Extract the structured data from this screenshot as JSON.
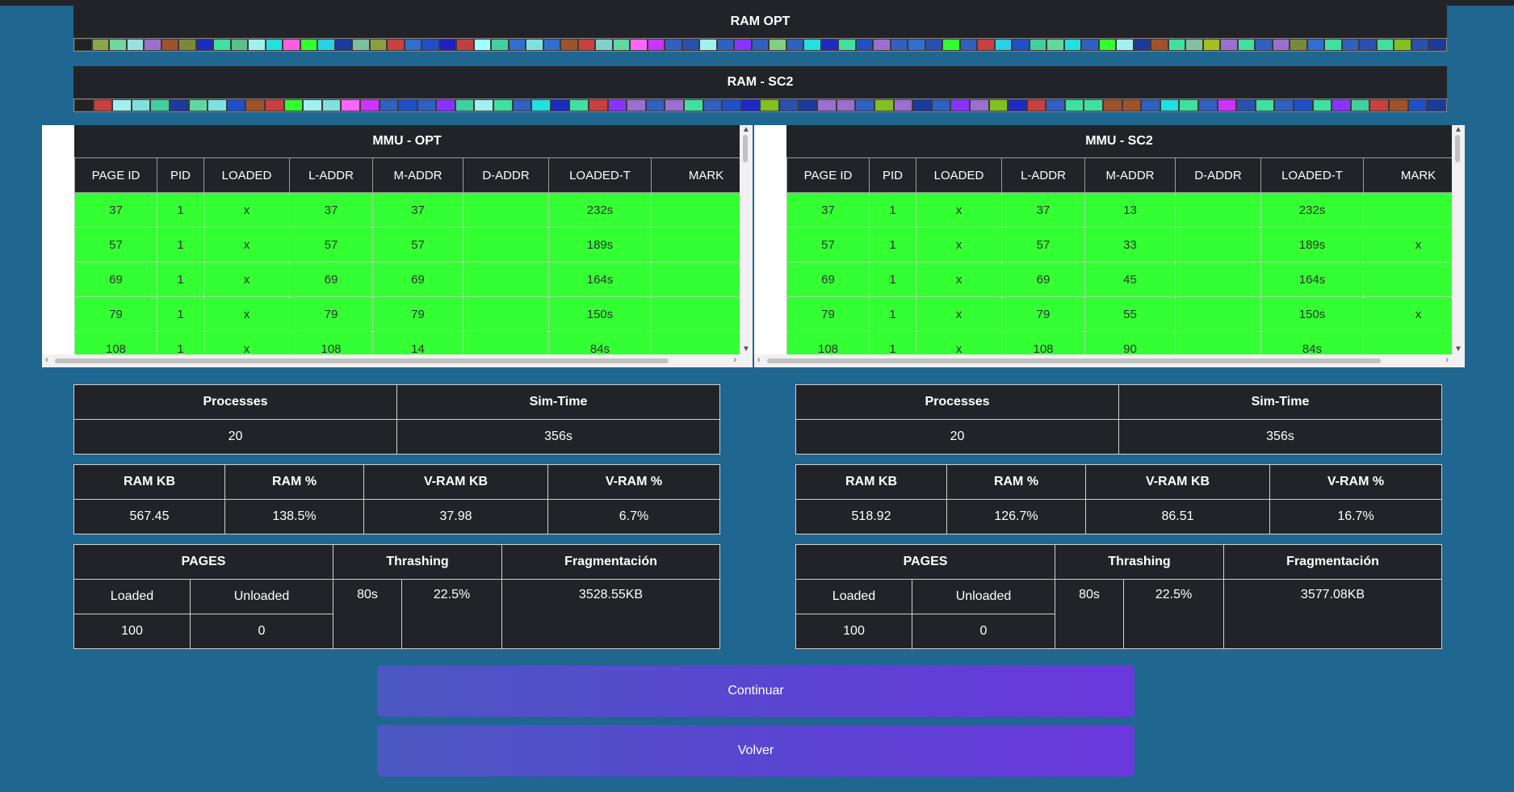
{
  "colors": {
    "background": "#1f6690",
    "panel": "#212328",
    "loaded_row": "#33ff33",
    "button_gradient": [
      "#4b58c0",
      "#6a38dc"
    ]
  },
  "ram_opt": {
    "title": "RAM OPT",
    "cells": [
      "#222",
      "#8aa64a",
      "#6fd7a0",
      "#97e0e0",
      "#9b6fd0",
      "#a0522d",
      "#7a8a3a",
      "#1c2ac2",
      "#40e0a0",
      "#58c08a",
      "#a0f0f0",
      "#20e0e0",
      "#ff5fe0",
      "#30ff30",
      "#28d0e8",
      "#1c3a9c",
      "#7ac0a0",
      "#8aa040",
      "#c84040",
      "#2f6fd0",
      "#2050c8",
      "#2020c0",
      "#c04040",
      "#a0ffff",
      "#40d0a0",
      "#2f6fd0",
      "#80e0e0",
      "#2f6fd0",
      "#a0522d",
      "#c84040",
      "#80d0d0",
      "#60d8a0",
      "#ff66ff",
      "#cc33ff",
      "#3060c0",
      "#2a50b0",
      "#a0f0f0",
      "#3060c0",
      "#8833ff",
      "#3060c0",
      "#80d080",
      "#3060c0",
      "#20e0e0",
      "#1c2ac2",
      "#40e0a0",
      "#2050c8",
      "#9b6fd0",
      "#3060c0",
      "#2f6fd0",
      "#2a50b0",
      "#30ff30",
      "#3060c0",
      "#c84040",
      "#28d0e8",
      "#2050c8",
      "#40d0a0",
      "#60d8a0",
      "#20e0e0",
      "#3060c0",
      "#30ff30",
      "#a0f0f0",
      "#1c3a9c",
      "#a0522d",
      "#40e0a0",
      "#80c0a0",
      "#a0c020",
      "#9b6fd0",
      "#40e0a0",
      "#3060c0",
      "#9b6fd0",
      "#7a8a3a",
      "#2f6fd0",
      "#40e0a0",
      "#3060c0",
      "#2a50b0",
      "#40e0a0",
      "#80c020",
      "#2a50b0",
      "#1c3a9c"
    ]
  },
  "ram_sc2": {
    "title": "RAM - SC2",
    "cells": [
      "#222",
      "#c84040",
      "#a0f0f0",
      "#80e0e0",
      "#40d0a0",
      "#1c3a9c",
      "#60d8a0",
      "#80e0e0",
      "#2050c8",
      "#a0522d",
      "#c84040",
      "#30ff30",
      "#a0f0f0",
      "#80e0e0",
      "#ff66ff",
      "#cc33ff",
      "#3060c0",
      "#2050c8",
      "#3060c0",
      "#8833ff",
      "#40d0a0",
      "#a0f0f0",
      "#40e0a0",
      "#3060c0",
      "#20e0e0",
      "#1c2ac2",
      "#40e0a0",
      "#c84040",
      "#8833ff",
      "#9b6fd0",
      "#3060c0",
      "#9b6fd0",
      "#40e0a0",
      "#3060c0",
      "#2050c8",
      "#1c2ac2",
      "#80c020",
      "#2a50b0",
      "#1c3a9c",
      "#9b6fd0",
      "#9b6fd0",
      "#3060c0",
      "#80c020",
      "#9b6fd0",
      "#1c3a9c",
      "#3060c0",
      "#8833ff",
      "#9b6fd0",
      "#80c020",
      "#1c2ac2",
      "#c84040",
      "#3060c0",
      "#40e0a0",
      "#40e0a0",
      "#a0522d",
      "#a0522d",
      "#3060c0",
      "#20e0e0",
      "#40e0a0",
      "#3060c0",
      "#cc33ff",
      "#2a50b0",
      "#40e0a0",
      "#3060c0",
      "#2050c8",
      "#40e0a0",
      "#8833ff",
      "#40d0a0",
      "#c84040",
      "#a0522d",
      "#2050c8",
      "#1c3a9c"
    ]
  },
  "mmu_columns": [
    "PAGE ID",
    "PID",
    "LOADED",
    "L-ADDR",
    "M-ADDR",
    "D-ADDR",
    "LOADED-T",
    "MARK"
  ],
  "mmu_opt": {
    "title": "MMU - OPT",
    "rows": [
      [
        "37",
        "1",
        "x",
        "37",
        "37",
        "",
        "232s",
        ""
      ],
      [
        "57",
        "1",
        "x",
        "57",
        "57",
        "",
        "189s",
        ""
      ],
      [
        "69",
        "1",
        "x",
        "69",
        "69",
        "",
        "164s",
        ""
      ],
      [
        "79",
        "1",
        "x",
        "79",
        "79",
        "",
        "150s",
        ""
      ],
      [
        "108",
        "1",
        "x",
        "108",
        "14",
        "",
        "84s",
        ""
      ]
    ]
  },
  "mmu_sc2": {
    "title": "MMU - SC2",
    "rows": [
      [
        "37",
        "1",
        "x",
        "37",
        "13",
        "",
        "232s",
        ""
      ],
      [
        "57",
        "1",
        "x",
        "57",
        "33",
        "",
        "189s",
        "x"
      ],
      [
        "69",
        "1",
        "x",
        "69",
        "45",
        "",
        "164s",
        ""
      ],
      [
        "79",
        "1",
        "x",
        "79",
        "55",
        "",
        "150s",
        "x"
      ],
      [
        "108",
        "1",
        "x",
        "108",
        "90",
        "",
        "84s",
        ""
      ]
    ]
  },
  "stats_opt": {
    "processes_label": "Processes",
    "processes": "20",
    "simtime_label": "Sim-Time",
    "simtime": "356s",
    "ram_kb_label": "RAM KB",
    "ram_kb": "567.45",
    "ram_pct_label": "RAM %",
    "ram_pct": "138.5%",
    "vram_kb_label": "V-RAM KB",
    "vram_kb": "37.98",
    "vram_pct_label": "V-RAM %",
    "vram_pct": "6.7%",
    "pages_label": "PAGES",
    "loaded_label": "Loaded",
    "unloaded_label": "Unloaded",
    "loaded": "100",
    "unloaded": "0",
    "thrashing_label": "Thrashing",
    "thrashing_time": "80s",
    "thrashing_pct": "22.5%",
    "frag_label": "Fragmentación",
    "frag": "3528.55KB"
  },
  "stats_sc2": {
    "processes_label": "Processes",
    "processes": "20",
    "simtime_label": "Sim-Time",
    "simtime": "356s",
    "ram_kb_label": "RAM KB",
    "ram_kb": "518.92",
    "ram_pct_label": "RAM %",
    "ram_pct": "126.7%",
    "vram_kb_label": "V-RAM KB",
    "vram_kb": "86.51",
    "vram_pct_label": "V-RAM %",
    "vram_pct": "16.7%",
    "pages_label": "PAGES",
    "loaded_label": "Loaded",
    "unloaded_label": "Unloaded",
    "loaded": "100",
    "unloaded": "0",
    "thrashing_label": "Thrashing",
    "thrashing_time": "80s",
    "thrashing_pct": "22.5%",
    "frag_label": "Fragmentación",
    "frag": "3577.08KB"
  },
  "buttons": {
    "continue": "Continuar",
    "back": "Volver"
  }
}
